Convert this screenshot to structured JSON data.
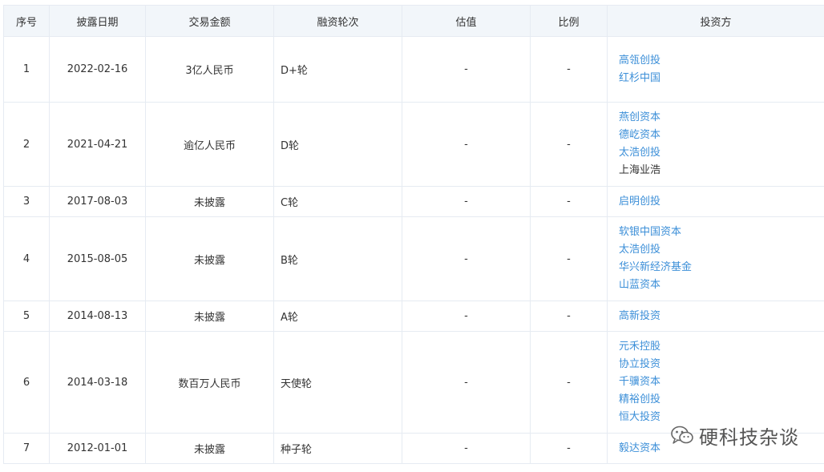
{
  "headers": {
    "index": "序号",
    "date": "披露日期",
    "amount": "交易金额",
    "round": "融资轮次",
    "valuation": "估值",
    "ratio": "比例",
    "investors": "投资方"
  },
  "rows": [
    {
      "index": "1",
      "date": "2022-02-16",
      "amount": "3亿人民币",
      "round": "D+轮",
      "valuation": "-",
      "ratio": "-",
      "investors": [
        {
          "name": "高瓴创投",
          "link": true
        },
        {
          "name": "红杉中国",
          "link": true
        }
      ]
    },
    {
      "index": "2",
      "date": "2021-04-21",
      "amount": "逾亿人民币",
      "round": "D轮",
      "valuation": "-",
      "ratio": "-",
      "investors": [
        {
          "name": "燕创资本",
          "link": true
        },
        {
          "name": "德屹资本",
          "link": true
        },
        {
          "name": "太浩创投",
          "link": true
        },
        {
          "name": "上海业浩",
          "link": false
        }
      ]
    },
    {
      "index": "3",
      "date": "2017-08-03",
      "amount": "未披露",
      "round": "C轮",
      "valuation": "-",
      "ratio": "-",
      "investors": [
        {
          "name": "启明创投",
          "link": true
        }
      ]
    },
    {
      "index": "4",
      "date": "2015-08-05",
      "amount": "未披露",
      "round": "B轮",
      "valuation": "-",
      "ratio": "-",
      "investors": [
        {
          "name": "软银中国资本",
          "link": true
        },
        {
          "name": "太浩创投",
          "link": true
        },
        {
          "name": "华兴新经济基金",
          "link": true
        },
        {
          "name": "山蓝资本",
          "link": true
        }
      ]
    },
    {
      "index": "5",
      "date": "2014-08-13",
      "amount": "未披露",
      "round": "A轮",
      "valuation": "-",
      "ratio": "-",
      "investors": [
        {
          "name": "高新投资",
          "link": true
        }
      ]
    },
    {
      "index": "6",
      "date": "2014-03-18",
      "amount": "数百万人民币",
      "round": "天使轮",
      "valuation": "-",
      "ratio": "-",
      "investors": [
        {
          "name": "元禾控股",
          "link": true
        },
        {
          "name": "协立投资",
          "link": true
        },
        {
          "name": "千骥资本",
          "link": true
        },
        {
          "name": "精裕创投",
          "link": true
        },
        {
          "name": "恒大投资",
          "link": true
        }
      ]
    },
    {
      "index": "7",
      "date": "2012-01-01",
      "amount": "未披露",
      "round": "种子轮",
      "valuation": "-",
      "ratio": "-",
      "investors": [
        {
          "name": "毅达资本",
          "link": true
        }
      ]
    }
  ],
  "watermark": {
    "text": "硬科技杂谈",
    "icon": "wechat-icon"
  },
  "colors": {
    "link": "#3c8fd8",
    "header_bg": "#f2f6fa",
    "border": "#e6ebf2",
    "text": "#333333"
  }
}
